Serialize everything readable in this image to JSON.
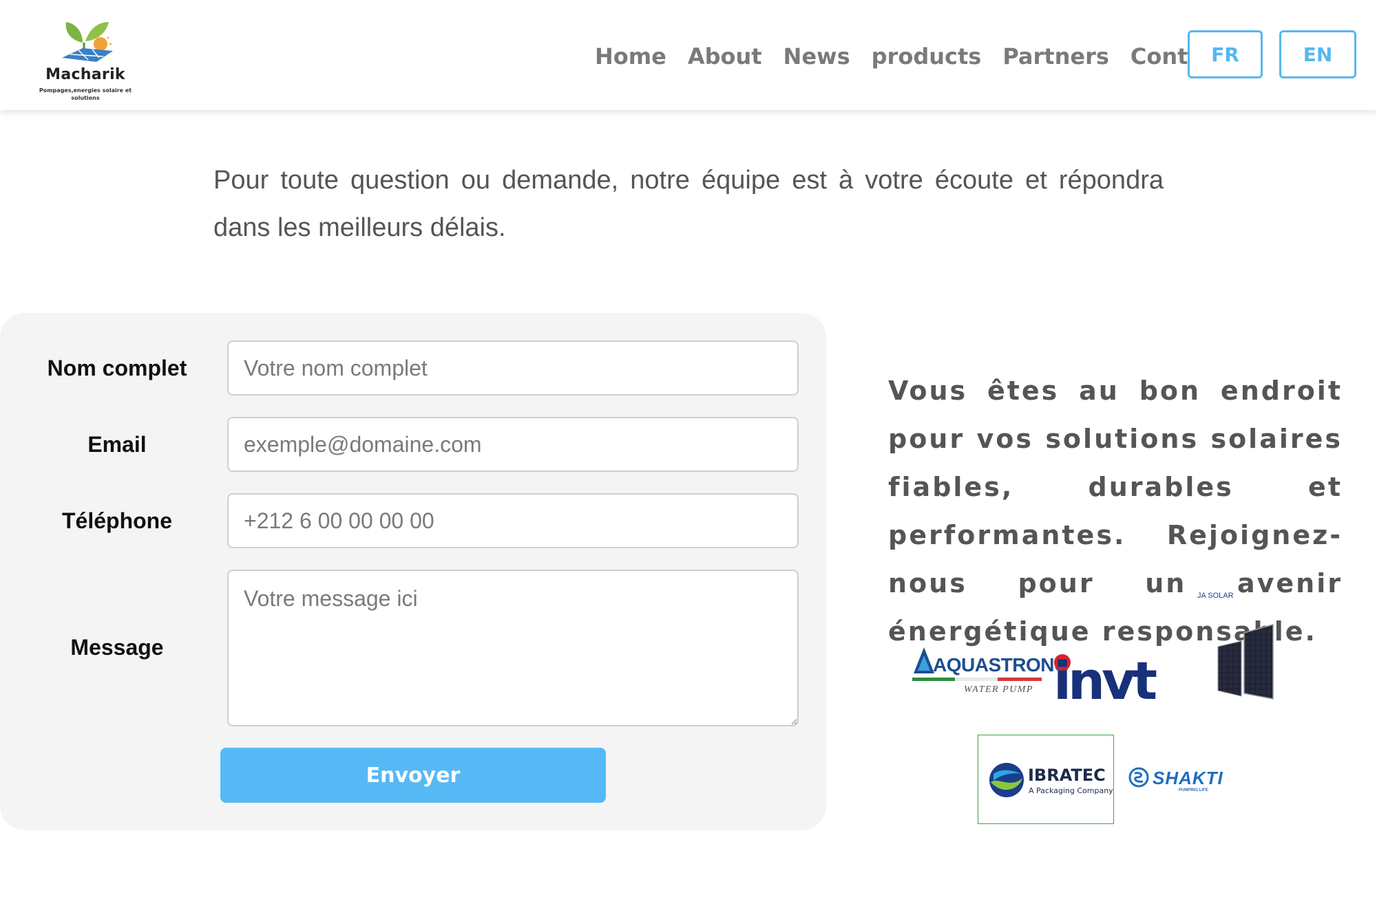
{
  "brand": {
    "name": "Macharik",
    "tagline": "Pompages,energies solaire et solutions",
    "leaf_color": "#7cb442",
    "sun_color": "#f2a13a",
    "panel_color": "#3b7fc4"
  },
  "nav": {
    "links": [
      "Home",
      "About",
      "News",
      "products",
      "Partners",
      "Contact"
    ],
    "languages": [
      "FR",
      "EN"
    ],
    "link_color": "#7a7a7a",
    "accent_color": "#56b7ee"
  },
  "intro": {
    "text": "Pour toute question ou demande, notre équipe est à votre écoute et répondra dans les meilleurs délais."
  },
  "form": {
    "fields": [
      {
        "label": "Nom complet",
        "placeholder": "Votre nom complet"
      },
      {
        "label": "Email",
        "placeholder": "exemple@domaine.com"
      },
      {
        "label": "Téléphone",
        "placeholder": "+212 6 00 00 00 00"
      },
      {
        "label": "Message",
        "placeholder": "Votre message ici"
      }
    ],
    "submit_label": "Envoyer",
    "submit_color": "#56b9f5",
    "panel_color": "#f4f4f4"
  },
  "side": {
    "tagline": "Vous êtes au bon endroit pour vos solutions solaires fiables, durables et performantes. Rejoignez-nous pour un avenir énergétique responsable."
  },
  "partners": {
    "aquastrong": {
      "name": "AQUASTRONG",
      "sub": "WATER PUMP"
    },
    "invt": {
      "name": "invt"
    },
    "jasolar": {
      "name": "JA SOLAR"
    },
    "ibratec": {
      "name": "IBRATEC",
      "sub": "A Packaging Company"
    },
    "shakti": {
      "name": "SHAKTI",
      "sub": "PUMPING LIFE"
    }
  }
}
